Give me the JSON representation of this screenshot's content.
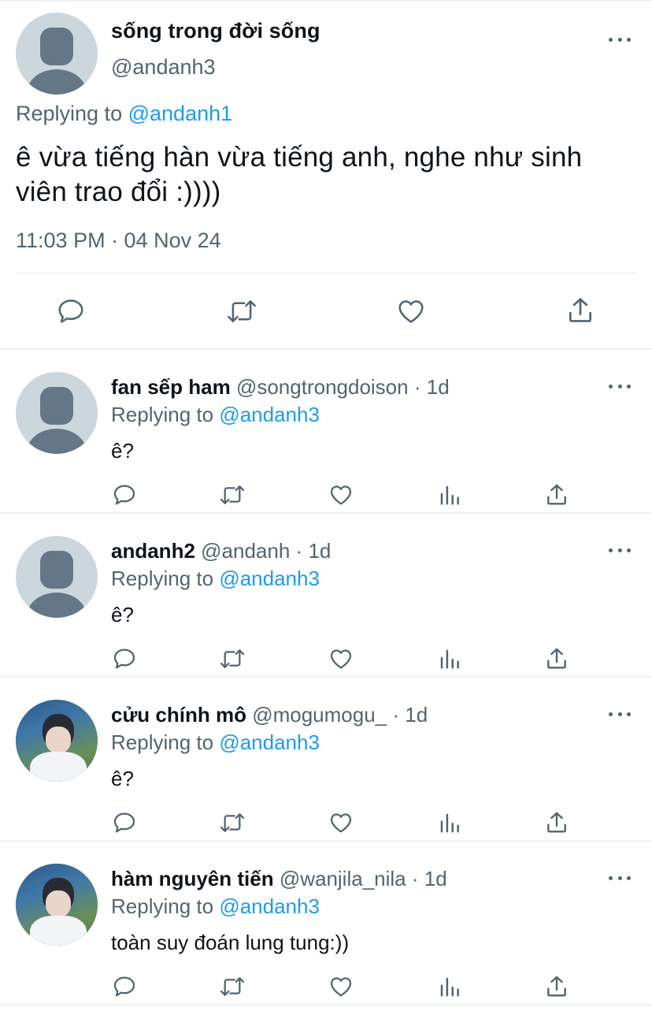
{
  "main_tweet": {
    "name": "sống trong đời sống",
    "handle": "@andanh3",
    "replying_label": "Replying to",
    "replying_to": "@andanh1",
    "text": "ê vừa tiếng hàn vừa tiếng anh, nghe như sinh viên trao đổi :))))",
    "timestamp": "11:03 PM · 04 Nov 24",
    "actions": [
      "reply-icon",
      "retweet-icon",
      "like-icon",
      "share-icon"
    ]
  },
  "replies": [
    {
      "name": "fan sếp ham",
      "handle": "@songtrongdoison",
      "time": "1d",
      "replying_label": "Replying to",
      "replying_to": "@andanh3",
      "text": "ê?",
      "avatar": "default-avatar"
    },
    {
      "name": "andanh2",
      "handle": "@andanh",
      "time": "1d",
      "replying_label": "Replying to",
      "replying_to": "@andanh3",
      "text": "ê?",
      "avatar": "default-avatar"
    },
    {
      "name": "cửu chính mô",
      "handle": "@mogumogu_",
      "time": "1d",
      "replying_label": "Replying to",
      "replying_to": "@andanh3",
      "text": "ê?",
      "avatar": "photo-avatar"
    },
    {
      "name": "hàm nguyên tiến",
      "handle": "@wanjila_nila",
      "time": "1d",
      "replying_label": "Replying to",
      "replying_to": "@andanh3",
      "text": "toàn suy đoán lung tung:))",
      "avatar": "photo-avatar"
    }
  ],
  "reply_actions": [
    "reply-icon",
    "retweet-icon",
    "like-icon",
    "analytics-icon",
    "share-icon"
  ],
  "colors": {
    "text": "#0f1419",
    "secondary": "#536471",
    "link": "#1d9bf0",
    "divider": "#eff3f4",
    "avatar_bg": "#ccd6dd",
    "avatar_fg": "#657786"
  }
}
